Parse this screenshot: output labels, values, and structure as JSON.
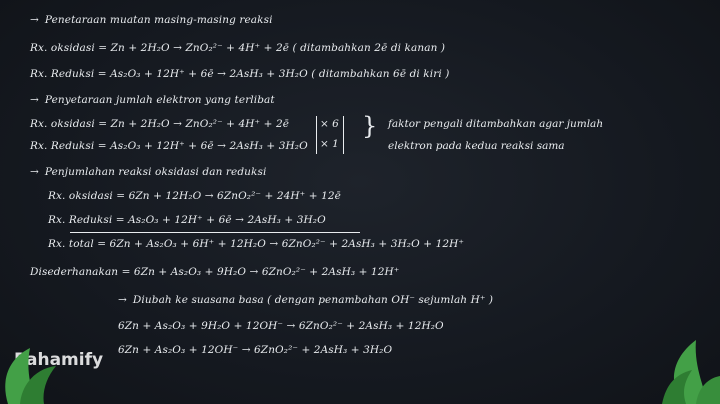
{
  "lines": [
    {
      "id": "l1",
      "text": "Penetaraan muatan masing-masing reaksi"
    },
    {
      "id": "l2",
      "text": "Rx. oksidasi  =  Zn + 2H₂O → ZnO₂²⁻ + 4H⁺ + 2ē     ( ditambahkan 2ē di kanan )"
    },
    {
      "id": "l3",
      "text": "Rx. Reduksi  =  As₂O₃ + 12H⁺ + 6ē → 2AsH₃ + 3H₂O    ( ditambahkan 6ē di kiri )"
    },
    {
      "id": "l4",
      "text": "Penyetaraan jumlah elektron yang terlibat"
    },
    {
      "id": "l5",
      "text": "Rx. oksidasi  =  Zn + 2H₂O → ZnO₂²⁻ + 4H⁺ + 2ē"
    },
    {
      "id": "l6",
      "text": "Rx. Reduksi  =  As₂O₃ + 12H⁺ + 6ē → 2AsH₃ + 3H₂O"
    },
    {
      "id": "l7",
      "text": "Penjumlahan reaksi oksidasi dan reduksi"
    },
    {
      "id": "l8",
      "text": "Rx. oksidasi  =  6Zn + 12H₂O → 6ZnO₂²⁻ + 24H⁺ + 12ē"
    },
    {
      "id": "l9",
      "text": "Rx. Reduksi  =  As₂O₃ + 12H⁺ + 6ē → 2AsH₃ + 3H₂O"
    },
    {
      "id": "l10",
      "text": "Rx. total  =  6Zn + As₂O₃ + 6H⁺ + 12H₂O → 6ZnO₂²⁻ + 2AsH₃ + 3H₂O + 12H⁺"
    },
    {
      "id": "l11",
      "text": "Disederhanakan  =  6Zn + As₂O₃ + 9H₂O → 6ZnO₂²⁻ + 2AsH₃ + 12H⁺"
    },
    {
      "id": "l12",
      "text": "Diubah ke suasana basa ( dengan penambahan OH⁻ sejumlah H⁺ )"
    },
    {
      "id": "l13",
      "text": "6Zn + As₂O₃ + 9H₂O + 12OH⁻ → 6ZnO₂²⁻ + 2AsH₃ + 12H₂O"
    },
    {
      "id": "l14",
      "text": "6Zn + As₂O₃ + 12OH⁻ → 6ZnO₂²⁻ + 2AsH₃ + 3H₂O"
    }
  ],
  "factors": {
    "top": "× 6",
    "bottom": "× 1"
  },
  "note": {
    "line1": "faktor pengali ditambahkan agar jumlah",
    "line2": "elektron pada kedua reaksi sama"
  },
  "brand": {
    "name": "Pahamify"
  }
}
